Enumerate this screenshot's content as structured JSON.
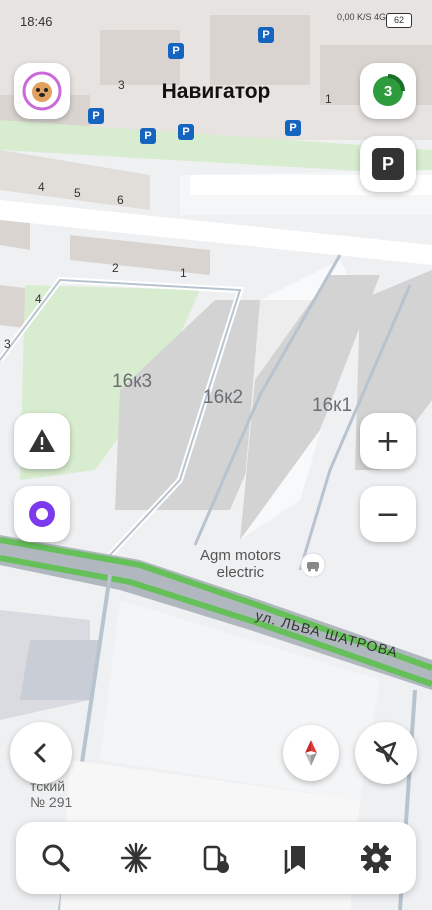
{
  "status_bar": {
    "time": "18:46",
    "network": "0,00 K/S",
    "signal": "4G",
    "battery": "62"
  },
  "title": "Навигатор",
  "notifications_count": "3",
  "parking_label": "P",
  "buildings": [
    "16к3",
    "16к2",
    "16к1"
  ],
  "entrances": [
    "3",
    "1",
    "4",
    "5",
    "6",
    "2",
    "1",
    "4",
    "3"
  ],
  "poi": {
    "name": "Agm motors electric",
    "line1": "Agm motors",
    "line2": "electric"
  },
  "street": "ул. ЛЬВА ШАТРОВА",
  "corner_text": {
    "line1": "тский",
    "line2": "№ 291"
  },
  "zoom": {
    "plus": "+",
    "minus": "−"
  },
  "bottom_nav": [
    "search-icon",
    "sunburst-icon",
    "fuel-icon",
    "bookmarks-icon",
    "settings-icon"
  ],
  "colors": {
    "route": "#4caf50",
    "parking": "#1565c0",
    "alice": "#7c3aed",
    "compass_red": "#e53935"
  }
}
